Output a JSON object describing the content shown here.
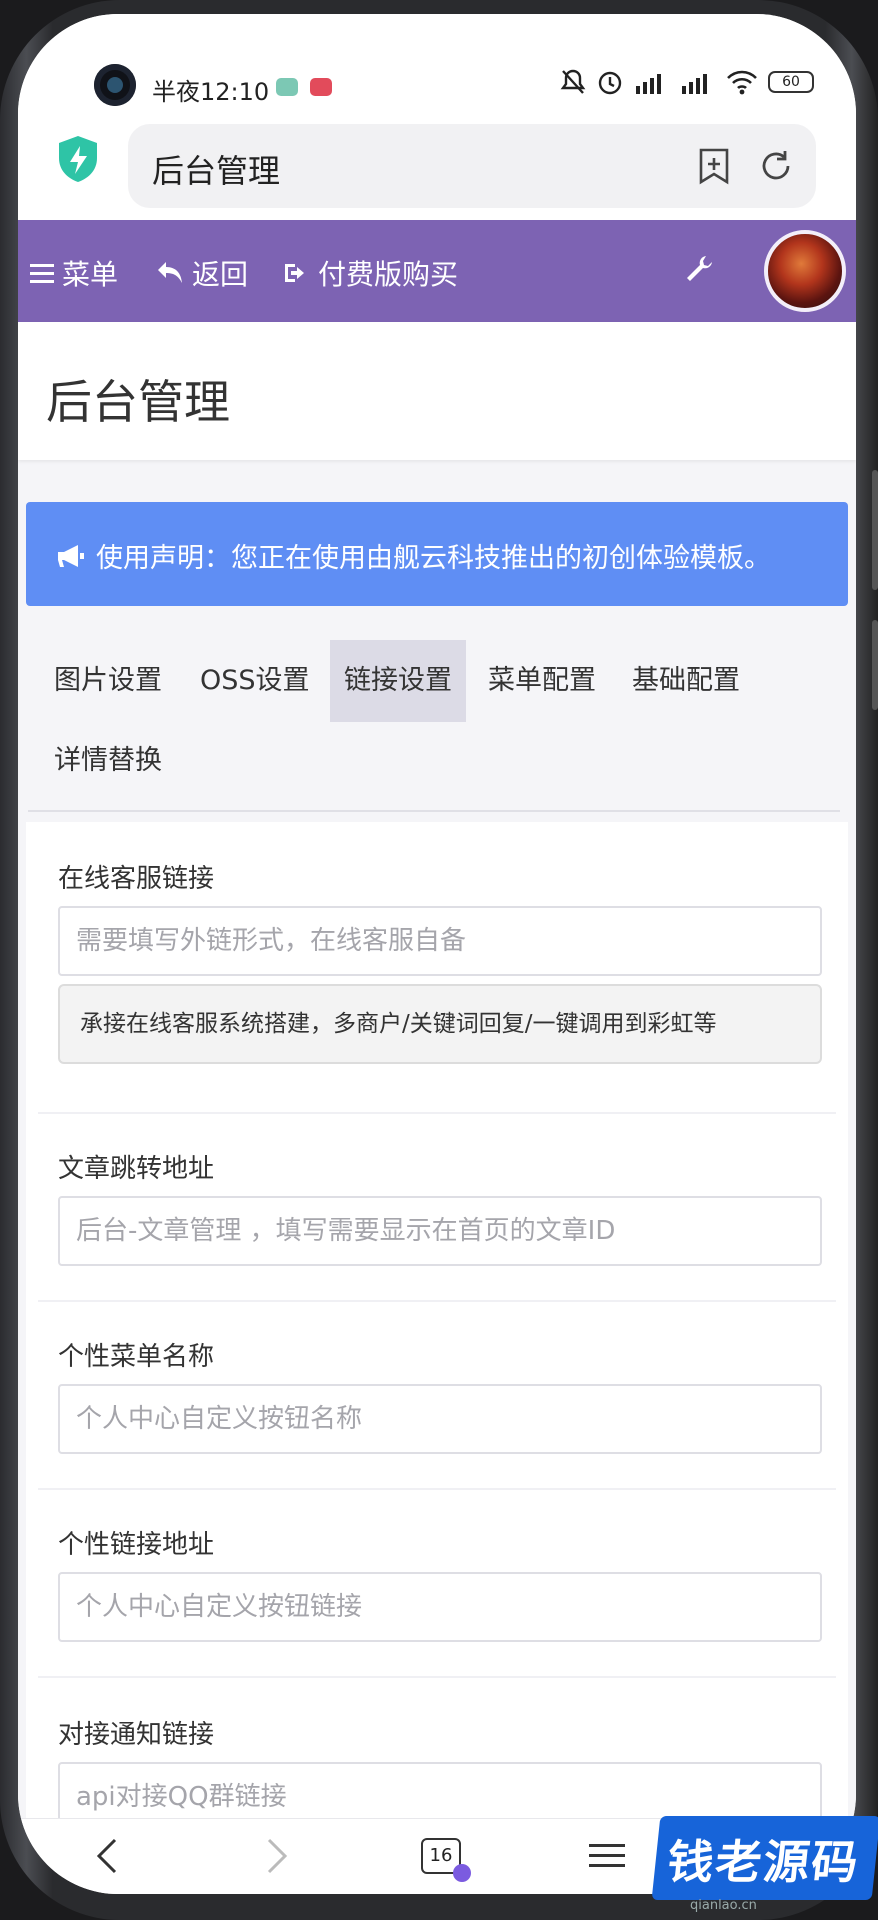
{
  "status": {
    "time": "半夜12:10",
    "battery": "60"
  },
  "browser": {
    "title": "后台管理",
    "tab_count": "16"
  },
  "nav": {
    "menu_label": "菜单",
    "back_label": "返回",
    "buy_label": "付费版购买"
  },
  "page": {
    "title": "后台管理"
  },
  "notice": {
    "text": "使用声明：您正在使用由舰云科技推出的初创体验模板。"
  },
  "tabs": [
    {
      "label": "图片设置"
    },
    {
      "label": "OSS设置"
    },
    {
      "label": "链接设置",
      "active": true
    },
    {
      "label": "菜单配置"
    },
    {
      "label": "基础配置"
    },
    {
      "label": "详情替换"
    }
  ],
  "form": {
    "fields": [
      {
        "label": "在线客服链接",
        "placeholder": "需要填写外链形式，在线客服自备",
        "note": "承接在线客服系统搭建，多商户/关键词回复/一键调用到彩虹等"
      },
      {
        "label": "文章跳转地址",
        "placeholder": "后台-文章管理 ，填写需要显示在首页的文章ID"
      },
      {
        "label": "个性菜单名称",
        "placeholder": "个人中心自定义按钮名称"
      },
      {
        "label": "个性链接地址",
        "placeholder": "个人中心自定义按钮链接"
      },
      {
        "label": "对接通知链接",
        "placeholder": "api对接QQ群链接"
      }
    ]
  },
  "watermark": {
    "text": "钱老源码",
    "sub": "qianlao.cn"
  },
  "colors": {
    "nav_bg": "#7d63b3",
    "notice_bg": "#5f8ef4",
    "active_tab_bg": "#dcdbe6"
  }
}
